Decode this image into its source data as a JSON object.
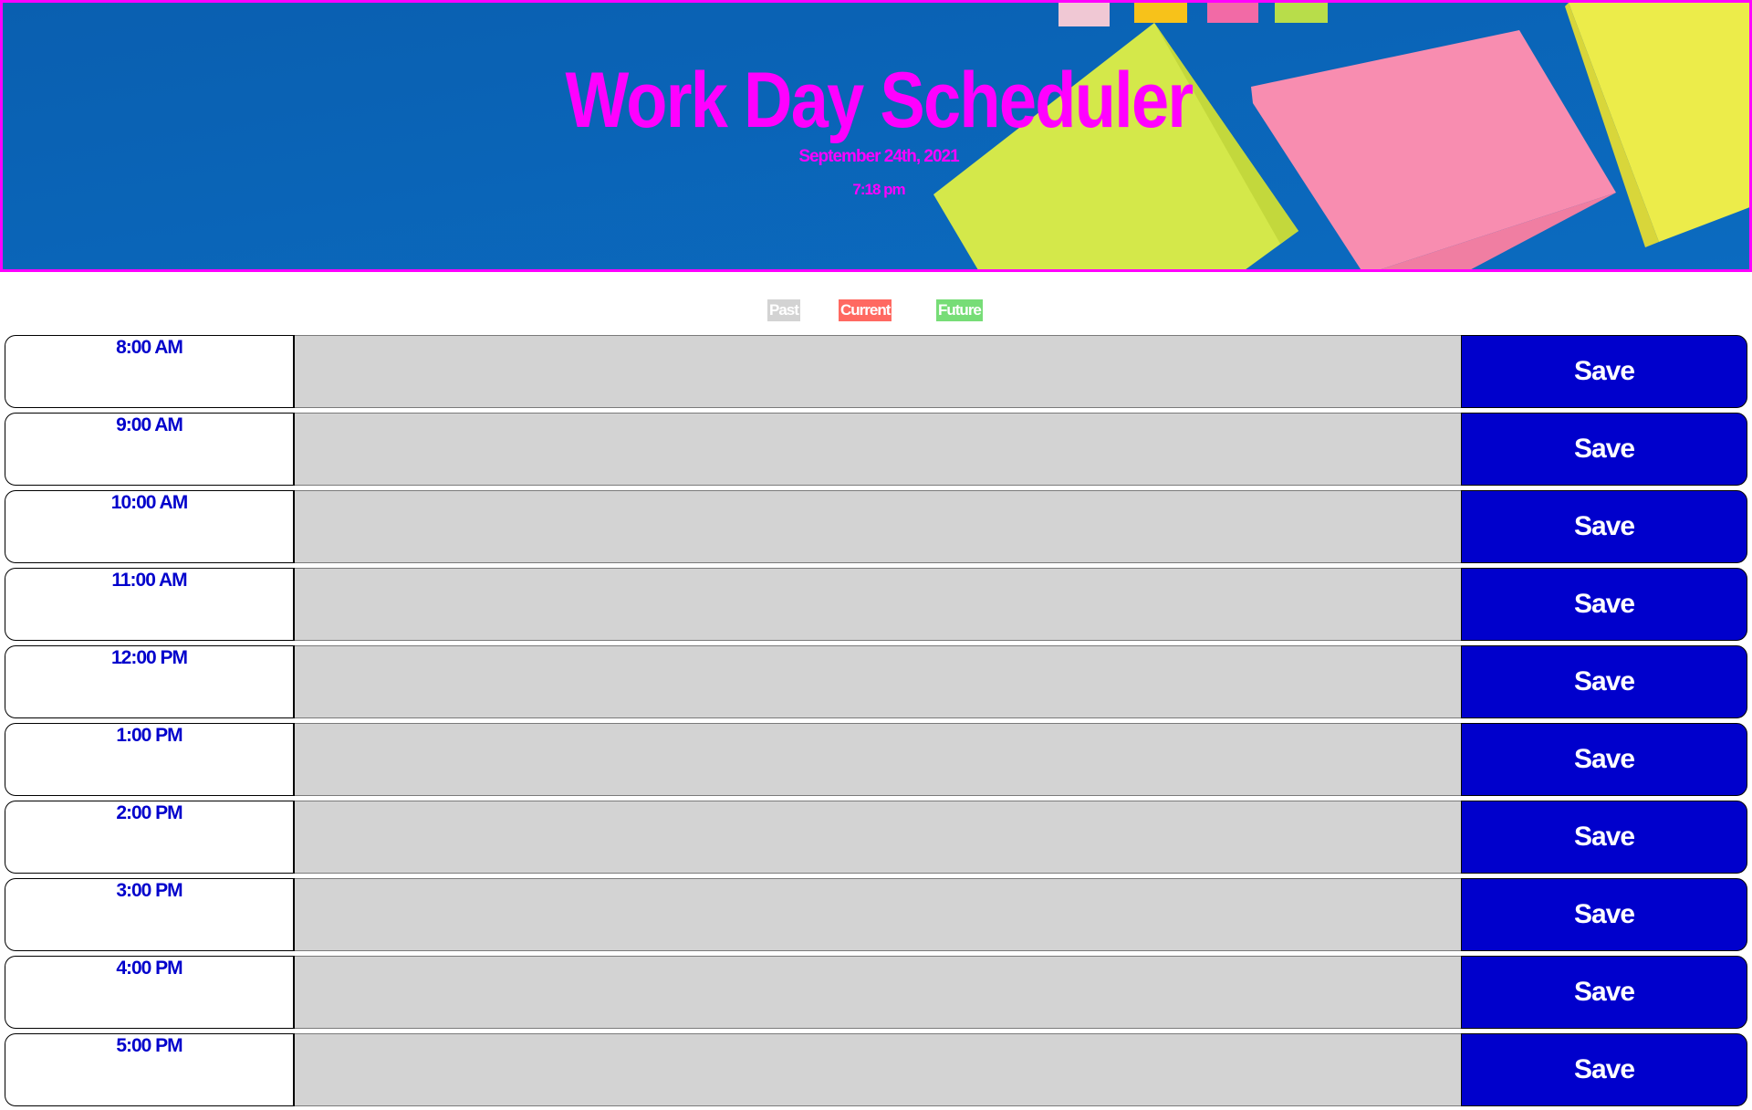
{
  "header": {
    "title": "Work Day Scheduler",
    "current_date": "September 24th, 2021",
    "current_time": "7:18 pm"
  },
  "legend": {
    "past": "Past",
    "present": "Current",
    "future": "Future"
  },
  "colors": {
    "accent": "#ff00ff",
    "header_background": "#0b63b5",
    "hour_text": "#0000cc",
    "save_button": "#0000cc",
    "past": "#d3d3d3",
    "present": "#ff6961",
    "future": "#77dd77"
  },
  "timeblocks": [
    {
      "hour": "8:00 AM",
      "state": "past",
      "description": "",
      "save_label": "Save"
    },
    {
      "hour": "9:00 AM",
      "state": "past",
      "description": "",
      "save_label": "Save"
    },
    {
      "hour": "10:00 AM",
      "state": "past",
      "description": "",
      "save_label": "Save"
    },
    {
      "hour": "11:00 AM",
      "state": "past",
      "description": "",
      "save_label": "Save"
    },
    {
      "hour": "12:00 PM",
      "state": "past",
      "description": "",
      "save_label": "Save"
    },
    {
      "hour": "1:00 PM",
      "state": "past",
      "description": "",
      "save_label": "Save"
    },
    {
      "hour": "2:00 PM",
      "state": "past",
      "description": "",
      "save_label": "Save"
    },
    {
      "hour": "3:00 PM",
      "state": "past",
      "description": "",
      "save_label": "Save"
    },
    {
      "hour": "4:00 PM",
      "state": "past",
      "description": "",
      "save_label": "Save"
    },
    {
      "hour": "5:00 PM",
      "state": "past",
      "description": "",
      "save_label": "Save"
    }
  ]
}
